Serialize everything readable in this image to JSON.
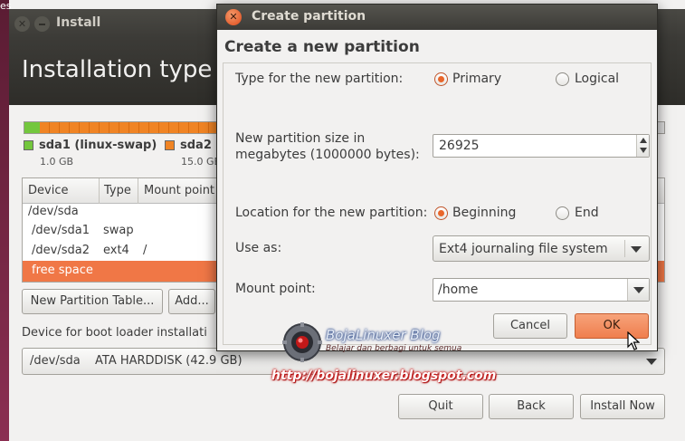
{
  "background_window": {
    "edge_label": "es",
    "title": "Install",
    "heading": "Installation type",
    "disk_segments": [
      {
        "name": "sda1 (linux-swap)",
        "size": "1.0 GB",
        "color": "#73c73d"
      },
      {
        "name": "sda2",
        "size": "15.0 GB",
        "color": "#f08424"
      }
    ],
    "table": {
      "columns": [
        "Device",
        "Type",
        "Mount point"
      ],
      "rows": [
        {
          "device": "/dev/sda",
          "type": "",
          "mount": ""
        },
        {
          "device": "/dev/sda1",
          "type": "swap",
          "mount": ""
        },
        {
          "device": "/dev/sda2",
          "type": "ext4",
          "mount": "/"
        },
        {
          "device": "free space",
          "type": "",
          "mount": ""
        }
      ]
    },
    "new_partition_table_button": "New Partition Table...",
    "add_button": "Add...",
    "boot_loader_label": "Device for boot loader installati",
    "boot_device": "/dev/sda",
    "boot_device_desc": "ATA HARDDISK (42.9 GB)",
    "quit_button": "Quit",
    "back_button": "Back",
    "install_now_button": "Install Now"
  },
  "dialog": {
    "title": "Create partition",
    "heading": "Create a new partition",
    "type_label": "Type for the new partition:",
    "type_options": {
      "primary": "Primary",
      "logical": "Logical",
      "selected": "primary"
    },
    "size_label_line1": "New partition size in",
    "size_label_line2": "megabytes (1000000 bytes):",
    "size_value": "26925",
    "location_label": "Location for the new partition:",
    "location_options": {
      "beginning": "Beginning",
      "end": "End",
      "selected": "beginning"
    },
    "use_as_label": "Use as:",
    "use_as_value": "Ext4 journaling file system",
    "mount_label": "Mount point:",
    "mount_value": "/home",
    "cancel_button": "Cancel",
    "ok_button": "OK"
  },
  "watermark": {
    "brand": "BojaLinuxer Blog",
    "tagline": "Belajar dan berbagi untuk semua",
    "url": "http://bojalinuxer.blogspot.com"
  },
  "colors": {
    "accent": "#e9662a",
    "selected_row": "#f07746",
    "titlebar": "#3c3b37"
  }
}
